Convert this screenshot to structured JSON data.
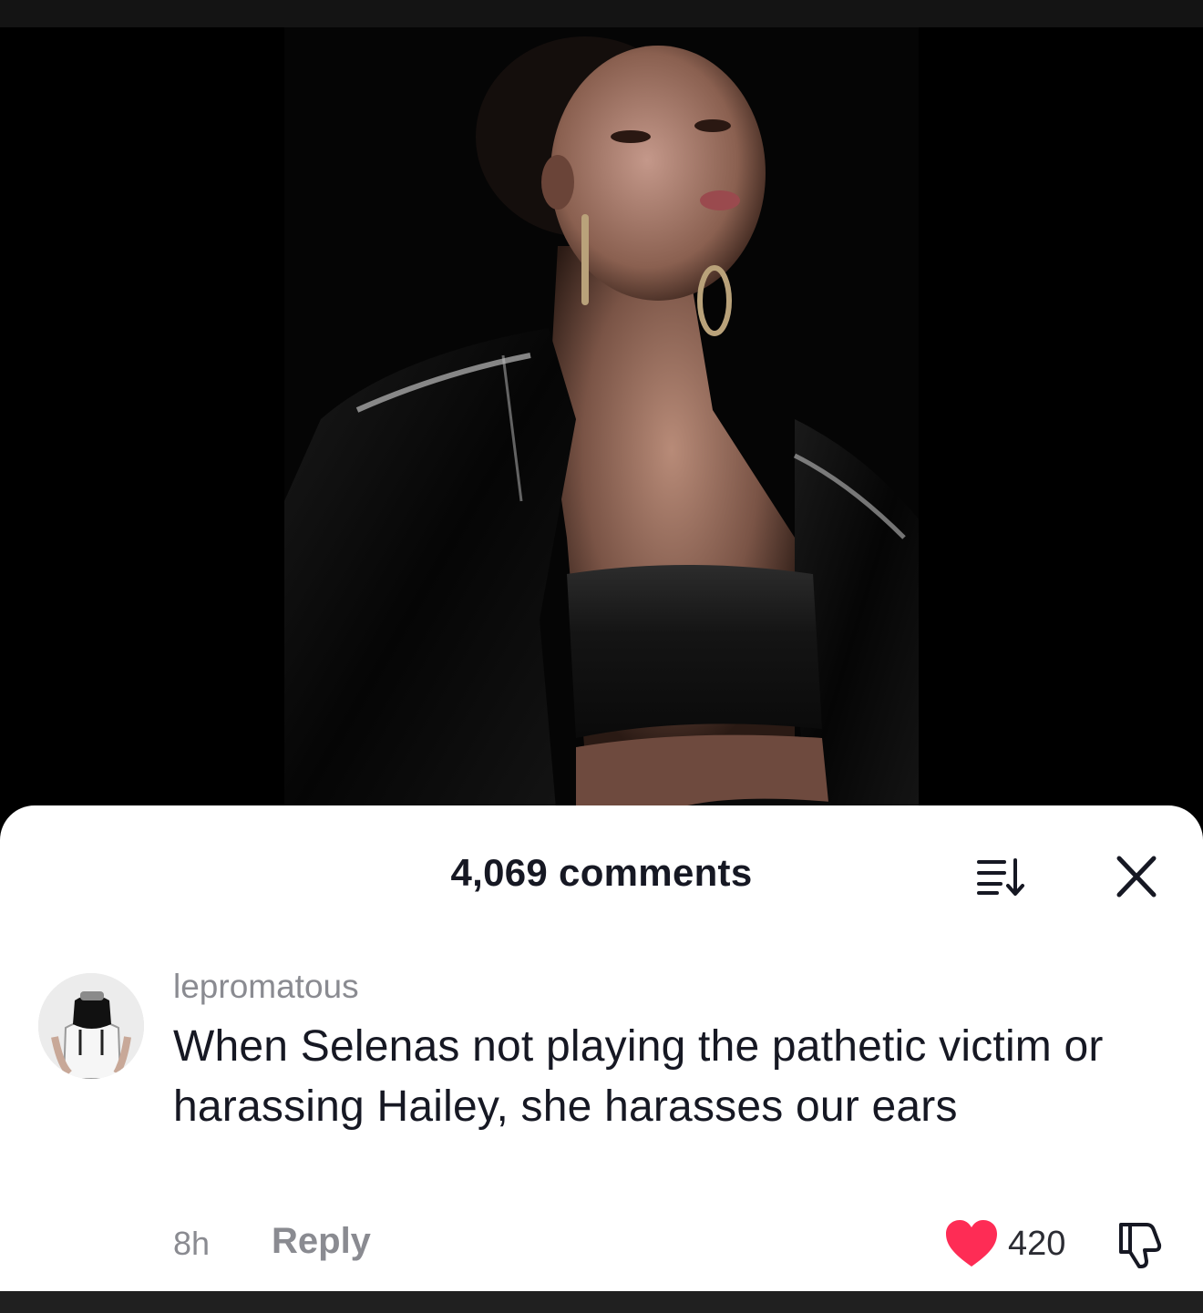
{
  "video": {
    "description_icon": "video-frame-icon"
  },
  "comments_sheet": {
    "count_label": "4,069 comments",
    "sort_icon": "sort-descending-icon",
    "close_icon": "close-icon"
  },
  "comment": {
    "username": "lepromatous",
    "avatar_icon": "avatar-icon",
    "text": "When Selenas not playing the pathetic victim or harassing Hailey, she harasses our ears",
    "time": "8h",
    "reply_label": "Reply",
    "like_icon": "heart-icon",
    "like_count": "420",
    "dislike_icon": "thumbs-down-icon"
  },
  "colors": {
    "like": "#fe2c55",
    "text_primary": "#161823",
    "text_secondary": "#8a8b91"
  }
}
